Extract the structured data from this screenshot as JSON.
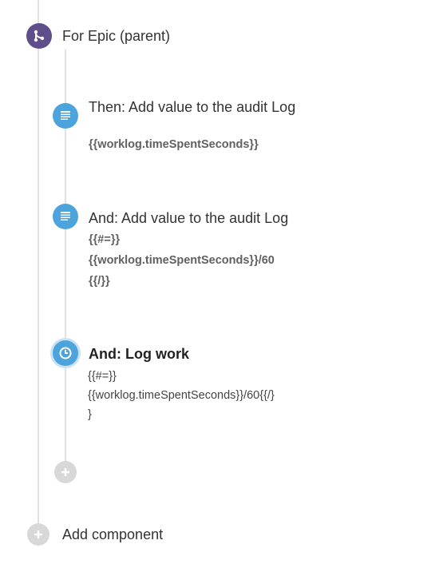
{
  "parent": {
    "title": "For Epic (parent)"
  },
  "actions": [
    {
      "title": "Then: Add value to the audit Log",
      "lines": [
        "{{worklog.timeSpentSeconds}}"
      ]
    },
    {
      "title": "And: Add value to the audit Log",
      "lines": [
        "{{#=}}",
        "{{worklog.timeSpentSeconds}}/60",
        "{{/}}"
      ]
    },
    {
      "title": "And: Log work",
      "lines": [
        "{{#=}}",
        "{{worklog.timeSpentSeconds}}/60{{/}",
        "}"
      ]
    }
  ],
  "footer": {
    "add_component": "Add component"
  },
  "colors": {
    "branch": "#5e4e8c",
    "action": "#4da3dc",
    "add": "#d8d8d8",
    "line": "#dfe1e6"
  },
  "icons": {
    "branch": "branch-icon",
    "action": "list-icon",
    "logwork": "clock-icon",
    "add": "plus-icon"
  }
}
